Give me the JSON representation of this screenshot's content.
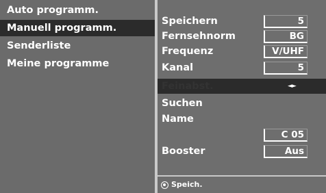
{
  "menu": {
    "items": [
      {
        "label": "Auto programm."
      },
      {
        "label": "Manuell programm."
      },
      {
        "label": "Senderliste"
      },
      {
        "label": "Meine programme"
      }
    ]
  },
  "settings": {
    "rows": [
      {
        "label": "Speichern",
        "value": "5"
      },
      {
        "label": "Fernsehnorm",
        "value": "BG"
      },
      {
        "label": "Frequenz",
        "value": "V/UHF"
      },
      {
        "label": "Kanal",
        "value": "5"
      },
      {
        "label": "Feinabst.",
        "value": "◄►"
      },
      {
        "label": "Suchen"
      },
      {
        "label": "Name"
      },
      {
        "value": "C 05"
      },
      {
        "label": "Booster",
        "value": "Aus"
      }
    ]
  },
  "footer": {
    "label": "Speich.",
    "icon": "ok-button-icon"
  },
  "colors": {
    "background": "#6e6e6e",
    "highlight": "#2b2b2b",
    "divider": "#c9c9c9",
    "text": "#ffffff"
  }
}
